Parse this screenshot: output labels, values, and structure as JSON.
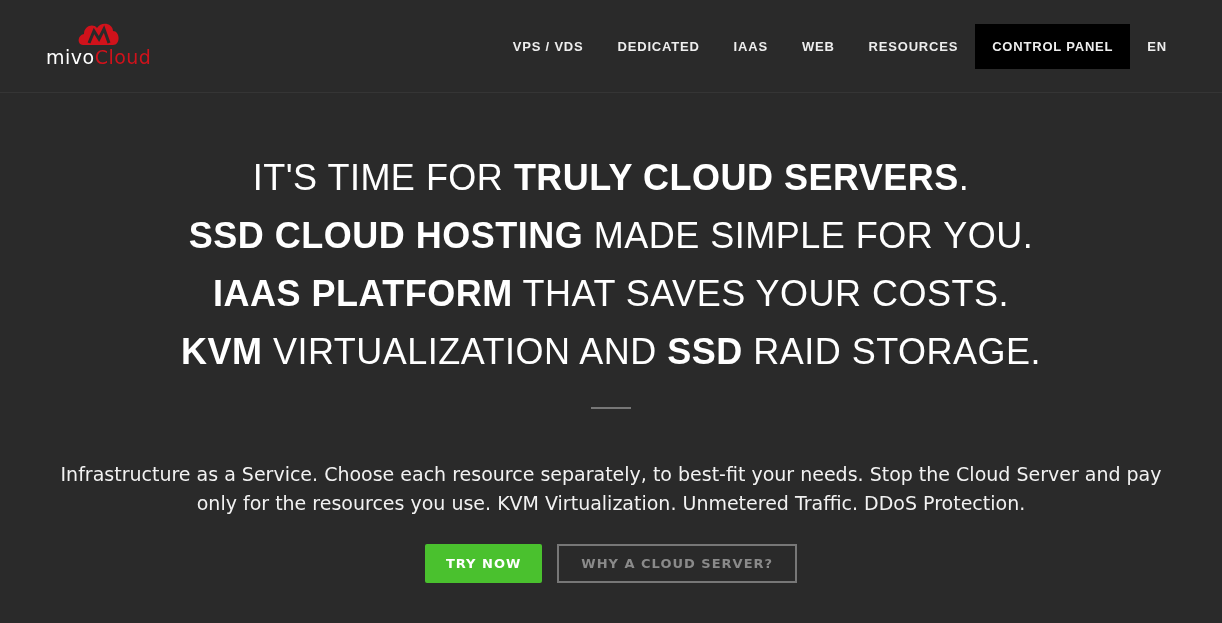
{
  "logo": {
    "text_1": "mivo",
    "text_2": "Cloud"
  },
  "nav": [
    {
      "label": "VPS / VDS",
      "selected": false
    },
    {
      "label": "DEDICATED",
      "selected": false
    },
    {
      "label": "IAAS",
      "selected": false
    },
    {
      "label": "WEB",
      "selected": false
    },
    {
      "label": "RESOURCES",
      "selected": false
    },
    {
      "label": "CONTROL PANEL",
      "selected": true
    },
    {
      "label": "EN",
      "selected": false
    }
  ],
  "hero": {
    "headlines": [
      "IT'S TIME FOR **TRULY CLOUD SERVERS**.",
      "**SSD CLOUD HOSTING** MADE SIMPLE FOR YOU.",
      "**IAAS PLATFORM** THAT SAVES YOUR COSTS.",
      "**KVM** VIRTUALIZATION AND **SSD** RAID STORAGE."
    ],
    "description": "Infrastructure as a Service. Choose each resource separately, to best-fit your needs. Stop the Cloud Server and pay only for the resources you use. KVM Virtualization. Unmetered Traffic. DDoS Protection.",
    "buttons": [
      {
        "label": "TRY NOW",
        "kind": "primary"
      },
      {
        "label": "WHY A CLOUD SERVER?",
        "kind": "outline"
      }
    ]
  }
}
